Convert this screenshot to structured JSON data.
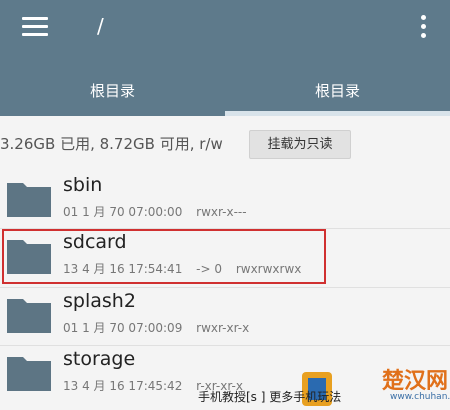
{
  "header": {
    "path": "/",
    "tabs": [
      {
        "label": "根目录"
      },
      {
        "label": "根目录"
      }
    ]
  },
  "status": {
    "text": "3.26GB 已用, 8.72GB 可用, r/w",
    "mount_button_label": "挂载为只读"
  },
  "files": [
    {
      "name": "sbin",
      "date": "01 1 月 70 07:00:00",
      "link": "",
      "perms": "rwxr-x---"
    },
    {
      "name": "sdcard",
      "date": "13 4 月 16 17:54:41",
      "link": "-> 0",
      "perms": "rwxrwxrwx"
    },
    {
      "name": "splash2",
      "date": "01 1 月 70 07:00:09",
      "link": "",
      "perms": "rwxr-xr-x"
    },
    {
      "name": "storage",
      "date": "13 4 月 16 17:45:42",
      "link": "",
      "perms": "r-xr-xr-x"
    }
  ],
  "watermark": {
    "text": "手机教授[s ] 更多手机玩法",
    "logo": "楚汉网",
    "url": "www.chuhan.com"
  },
  "colors": {
    "toolbar": "#5e7a8b",
    "folder": "#5d7584",
    "highlight": "#d03030"
  }
}
